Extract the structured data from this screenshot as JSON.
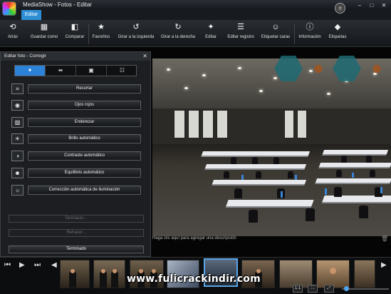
{
  "titlebar": {
    "title": "MediaShow - Fotos - Editar",
    "min": "–",
    "max": "□",
    "close": "✕",
    "update_icon": "↑"
  },
  "ribbon": {
    "tab_label": "Editar"
  },
  "toolbar": {
    "buttons": [
      {
        "label": "Atrás",
        "icon": "back-arrow-icon",
        "glyph": "⟲"
      },
      {
        "label": "Guardar como",
        "icon": "save-as-icon",
        "glyph": "▦"
      },
      {
        "label": "Comparar",
        "icon": "compare-icon",
        "glyph": "◧"
      },
      {
        "label": "Favoritos",
        "icon": "star-icon",
        "glyph": "★"
      },
      {
        "label": "Girar a la izquierda",
        "icon": "rotate-left-icon",
        "glyph": "↺"
      },
      {
        "label": "Girar a la derecha",
        "icon": "rotate-right-icon",
        "glyph": "↻"
      },
      {
        "label": "Editar",
        "icon": "magic-wand-icon",
        "glyph": "✦"
      },
      {
        "label": "Editar registro",
        "icon": "edit-log-icon",
        "glyph": "☰"
      },
      {
        "label": "Etiquetar caras",
        "icon": "tag-faces-icon",
        "glyph": "☺"
      },
      {
        "label": "Información",
        "icon": "info-icon",
        "glyph": "ⓘ"
      },
      {
        "label": "Etiquetas",
        "icon": "tag-icon",
        "glyph": "◆"
      }
    ]
  },
  "panel": {
    "title": "Editar foto - Corregir",
    "close": "✕",
    "segments": [
      {
        "glyph": "✦",
        "icon": "wand-tab-icon"
      },
      {
        "glyph": "⇹",
        "icon": "adjust-tab-icon"
      },
      {
        "glyph": "▣",
        "icon": "effects-tab-icon"
      },
      {
        "glyph": "☷",
        "icon": "list-tab-icon"
      }
    ],
    "options": [
      {
        "label": "Recortar",
        "glyph": "⌗",
        "icon": "crop-icon"
      },
      {
        "label": "Ojos rojos",
        "glyph": "◉",
        "icon": "eye-icon"
      },
      {
        "label": "Enderezar",
        "glyph": "▨",
        "icon": "straighten-icon"
      },
      {
        "label": "Brillo automático",
        "glyph": "☀",
        "icon": "brightness-icon"
      },
      {
        "label": "Contraste automático",
        "glyph": "◑",
        "icon": "contrast-icon"
      },
      {
        "label": "Equilibrio automático",
        "glyph": "☻",
        "icon": "balance-icon"
      },
      {
        "label": "Corrección automática de iluminación",
        "glyph": "☼",
        "icon": "lighting-icon"
      }
    ],
    "undo_label": "Deshacer...",
    "redo_label": "Rehacer...",
    "done_label": "Terminado"
  },
  "photo": {
    "caption": "Haga clic aquí para agregar una descripción"
  },
  "filmstrip": {
    "prev": "⏮",
    "play": "▶",
    "next": "⏭",
    "left_arrow": "◀",
    "right_arrow": "▶",
    "zoom_label": "1:1",
    "fit_label": "⛶",
    "full_label": "⤢",
    "zoom_level": 0.05
  },
  "watermark": "www.fulicrackindir.com"
}
